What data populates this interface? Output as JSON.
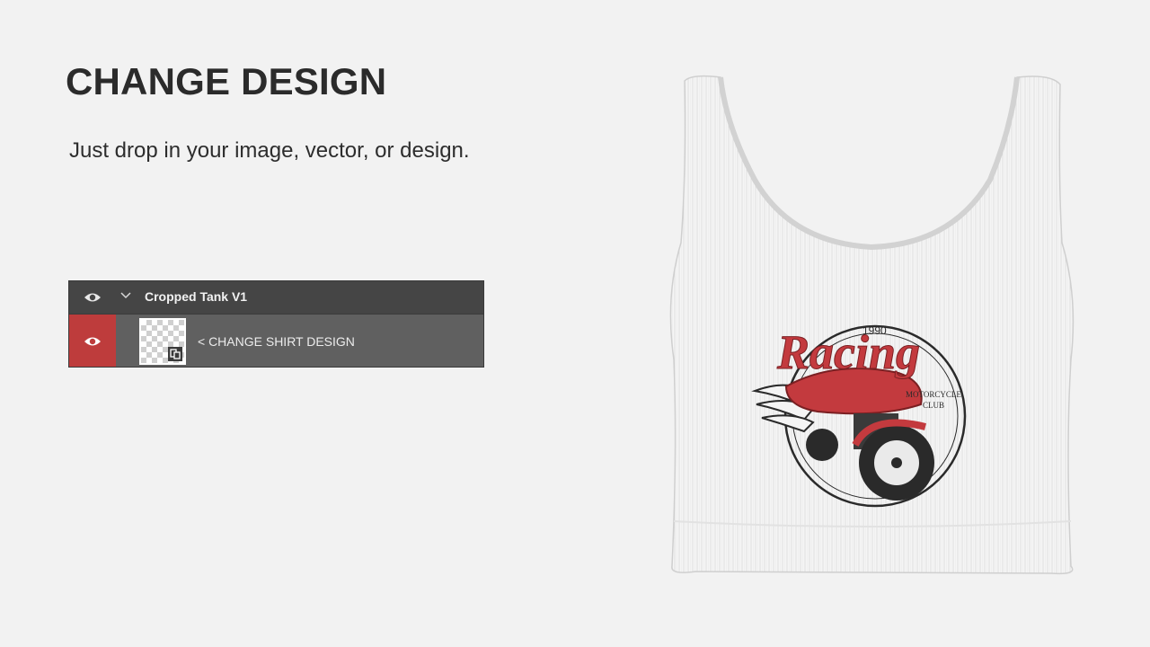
{
  "heading": "CHANGE DESIGN",
  "subheading": "Just drop in your image, vector, or design.",
  "layers_panel": {
    "group": {
      "name": "Cropped Tank V1",
      "visibility_icon": "eye-icon",
      "expand_icon": "chevron-down-icon"
    },
    "layer": {
      "name": "< CHANGE SHIRT DESIGN",
      "visibility_icon": "eye-icon",
      "thumbnail_icon": "smart-object-icon",
      "highlight_color": "#be3c3c"
    }
  },
  "product": {
    "type": "cropped tank top",
    "fabric_color": "#f4f4f4",
    "print": {
      "year": "1990",
      "script_title": "Racing",
      "badge_line1": "MOTORCYCLE",
      "badge_line2": "CLUB",
      "accent_color": "#c33a3e",
      "ink_color": "#222222"
    }
  }
}
